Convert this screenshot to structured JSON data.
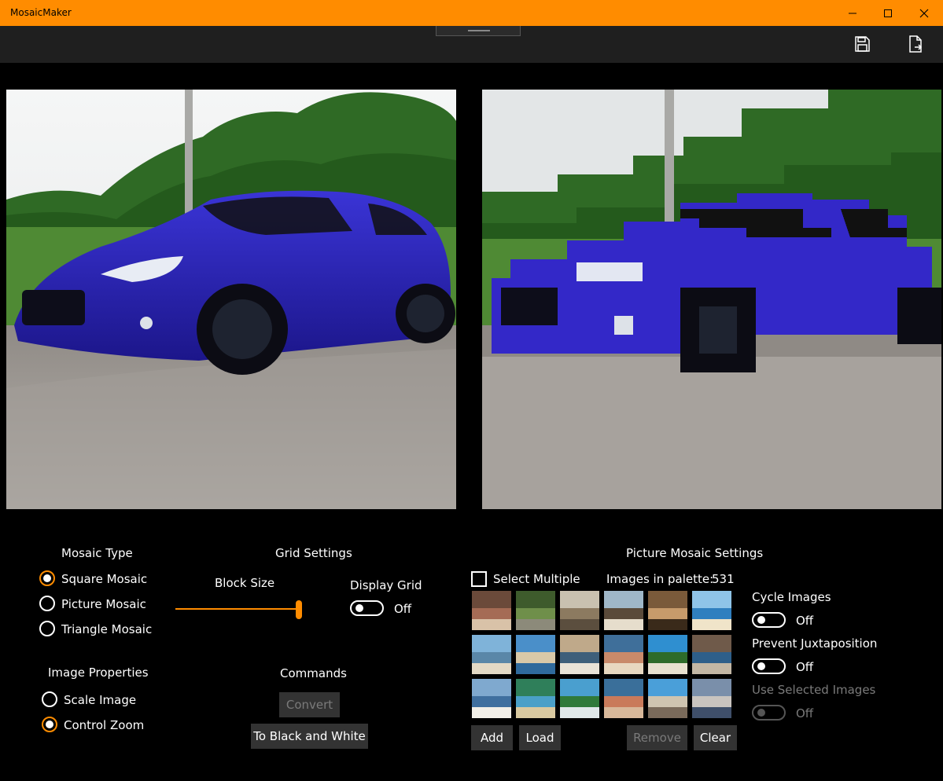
{
  "window": {
    "title": "MosaicMaker"
  },
  "icons": {
    "minimize": "minimize-icon",
    "maximize": "maximize-icon",
    "close": "close-icon",
    "save": "save-icon",
    "export": "export-icon"
  },
  "colors": {
    "accent": "#ff8c00",
    "background": "#000000",
    "commandbar": "#1f1f1f",
    "button": "#333333"
  },
  "mosaic_type": {
    "heading": "Mosaic Type",
    "options": [
      {
        "label": "Square Mosaic",
        "selected": true
      },
      {
        "label": "Picture Mosaic",
        "selected": false
      },
      {
        "label": "Triangle Mosaic",
        "selected": false
      }
    ]
  },
  "image_properties": {
    "heading": "Image Properties",
    "options": [
      {
        "label": "Scale Image",
        "selected": false
      },
      {
        "label": "Control Zoom",
        "selected": true
      }
    ]
  },
  "grid_settings": {
    "heading": "Grid Settings",
    "block_size_label": "Block Size",
    "block_size_value": 1.0,
    "display_grid_label": "Display Grid",
    "display_grid_state": "Off"
  },
  "commands": {
    "heading": "Commands",
    "convert_label": "Convert",
    "black_white_label": "To Black and White"
  },
  "picture_mosaic": {
    "heading": "Picture Mosaic Settings",
    "select_multiple_label": "Select Multiple",
    "palette_label": "Images in palette:",
    "palette_count": "531",
    "add_label": "Add",
    "load_label": "Load",
    "remove_label": "Remove",
    "clear_label": "Clear",
    "cycle_images_label": "Cycle Images",
    "cycle_images_state": "Off",
    "prevent_juxtaposition_label": "Prevent Juxtaposition",
    "prevent_juxtaposition_state": "Off",
    "use_selected_label": "Use Selected Images",
    "use_selected_state": "Off",
    "thumbnails": [
      "crowd",
      "tree-bunker",
      "beach-rocks",
      "boat-shore",
      "crafts",
      "beach-umbrella",
      "coast-cliffs",
      "resort-beach",
      "beach-stones",
      "harbor-town",
      "palm-tree",
      "rock-sea",
      "surf-coast",
      "tropical-bay",
      "green-island",
      "busy-beach",
      "city-beach",
      "skyline-coast"
    ]
  }
}
